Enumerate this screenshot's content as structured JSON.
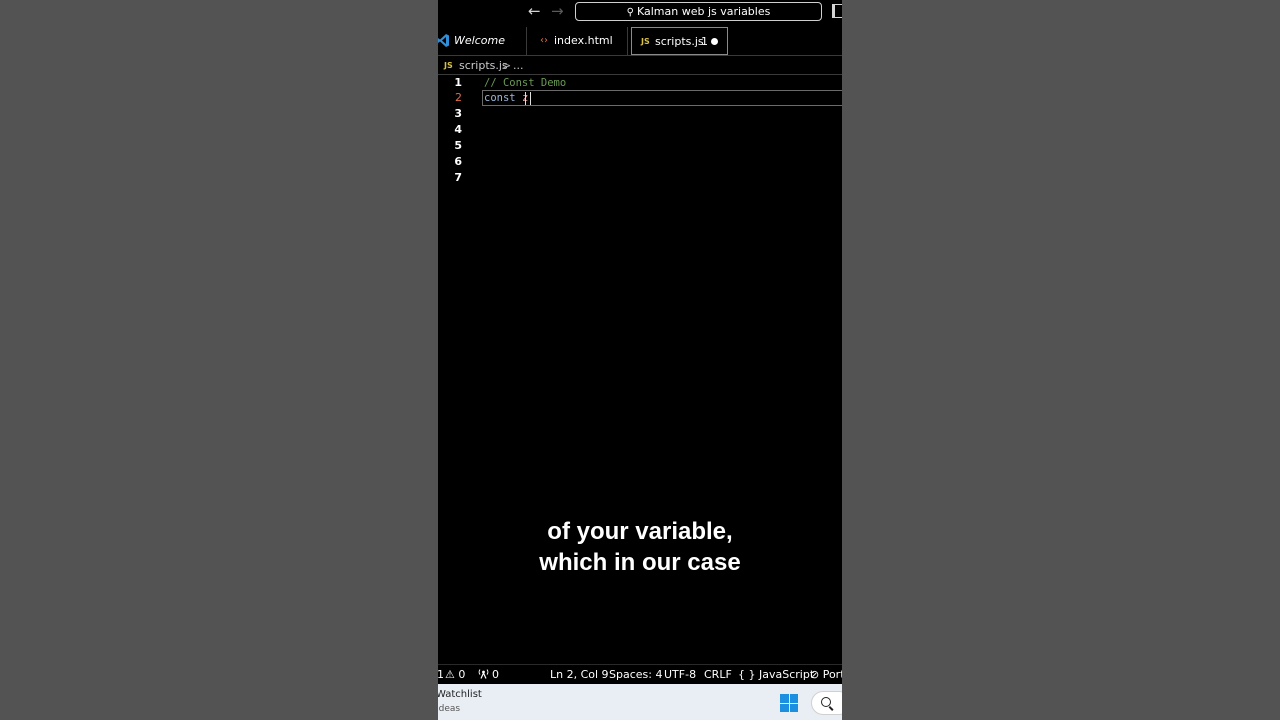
{
  "titlebar": {
    "back_icon": "←",
    "forward_icon": "→",
    "search_icon": "⚲",
    "search_text": "Kalman web js variables"
  },
  "tabs": [
    {
      "label": "Welcome",
      "icon": "vscode-logo-icon"
    },
    {
      "label": "index.html",
      "icon": "‹›"
    },
    {
      "label": "scripts.js",
      "icon": "JS",
      "problems": "1",
      "modified": true
    }
  ],
  "breadcrumb": {
    "icon": "JS",
    "file": "scripts.js",
    "separator": ">",
    "more": "..."
  },
  "editor": {
    "lines": [
      {
        "number": "1",
        "comment": "// Const Demo"
      },
      {
        "number": "2",
        "keyword": "const",
        "ident": "z"
      },
      {
        "number": "3"
      },
      {
        "number": "4"
      },
      {
        "number": "5"
      },
      {
        "number": "6"
      },
      {
        "number": "7"
      }
    ]
  },
  "subtitle": {
    "line1": "of your variable,",
    "line2": "which in our case"
  },
  "statusbar": {
    "errors": "1",
    "warnings": "⚠ 0",
    "ports": "0",
    "position": "Ln 2, Col 9",
    "spaces": "Spaces: 4",
    "encoding": "UTF-8",
    "eol": "CRLF",
    "language": "{ } JavaScript",
    "port_label": "⊘ Port"
  },
  "taskbar": {
    "line1": "Watchlist",
    "line2": "Ideas"
  },
  "colors": {
    "background": "#535353",
    "editor_bg": "#000000",
    "comment": "#6a9955",
    "keyword": "#9cb6d8",
    "active_line_number": "#e06c4a",
    "windows_blue": "#1d8fe0"
  }
}
